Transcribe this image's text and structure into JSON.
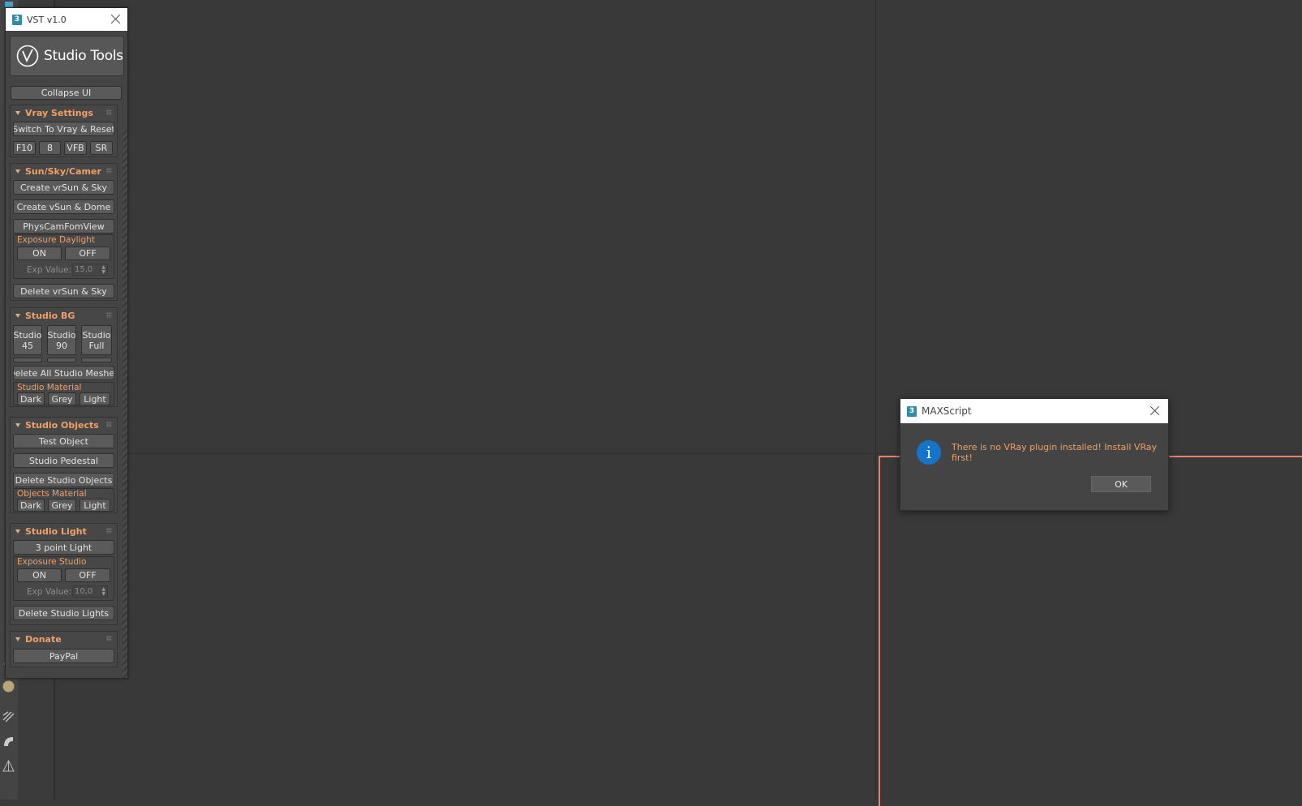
{
  "vst": {
    "title": "VST v1.0",
    "logo_text": "Studio Tools",
    "collapse_label": "Collapse UI",
    "vray_settings": {
      "header": "Vray Settings",
      "switch_label": "Switch To Vray & Reset",
      "btn_f10": "F10",
      "btn_8": "8",
      "btn_vfb": "VFB",
      "btn_sr": "SR"
    },
    "sun_sky": {
      "header": "Sun/Sky/Camer",
      "create_sun_sky": "Create vrSun & Sky",
      "create_sun_dome": "Create vSun & Dome",
      "phys_cam": "PhysCamFomView",
      "exposure_label": "Exposure Daylight",
      "on": "ON",
      "off": "OFF",
      "exp_label": "Exp Value:",
      "exp_value": "15,0",
      "delete_sun_sky": "Delete vrSun & Sky"
    },
    "studio_bg": {
      "header": "Studio BG",
      "studio45_a": "Studio",
      "studio45_b": "45",
      "studio90_a": "Studio",
      "studio90_b": "90",
      "studiofull_a": "Studio",
      "studiofull_b": "Full",
      "delete_meshes": "Delete All Studio Meshes",
      "material_label": "Studio Material",
      "dark": "Dark",
      "grey": "Grey",
      "light": "Light"
    },
    "studio_objects": {
      "header": "Studio Objects",
      "test_object": "Test Object",
      "pedestal": "Studio Pedestal",
      "delete_objects": "Delete Studio Objects",
      "material_label": "Objects Material",
      "dark": "Dark",
      "grey": "Grey",
      "light": "Light"
    },
    "studio_light": {
      "header": "Studio Light",
      "three_point": "3 point Light",
      "exposure_label": "Exposure Studio",
      "on": "ON",
      "off": "OFF",
      "exp_label": "Exp Value:",
      "exp_value": "10,0",
      "delete_lights": "Delete Studio Lights"
    },
    "donate": {
      "header": "Donate",
      "paypal": "PayPal"
    }
  },
  "dialog": {
    "title": "MAXScript",
    "message": "There is no VRay plugin installed! Install VRay first!",
    "ok_label": "OK",
    "icon": "info-icon"
  },
  "colors": {
    "accent_orange": "#f0a068",
    "active_viewport_border": "#e88070",
    "info_blue": "#1574c9",
    "app_icon": "#2f8da8"
  }
}
